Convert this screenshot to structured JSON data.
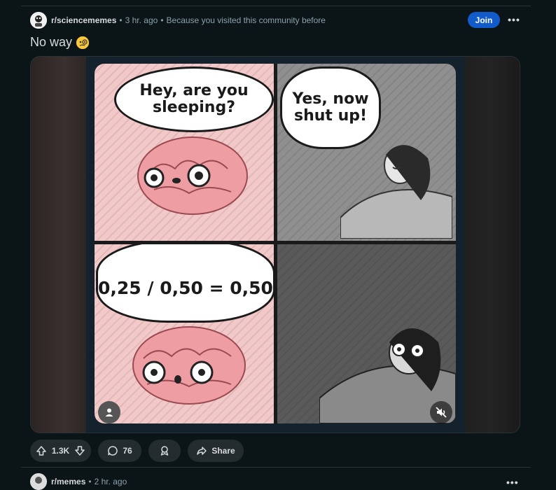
{
  "post": {
    "subreddit": "r/sciencememes",
    "time": "3 hr. ago",
    "reason": "Because you visited this community before",
    "join_label": "Join",
    "more_label": "•••",
    "title": "No way",
    "title_emoji": "face-with-monocle"
  },
  "meme": {
    "panel1_text": "Hey, are you sleeping?",
    "panel2_text": "Yes, now shut up!",
    "panel3_text": "0,25 / 0,50 = 0,50"
  },
  "actions": {
    "vote_count": "1.3K",
    "comments_count": "76",
    "share_label": "Share"
  },
  "next_post": {
    "subreddit": "r/memes",
    "time": "2 hr. ago",
    "more_label": "•••"
  },
  "colors": {
    "background": "#0b1416",
    "join_button": "#115bca",
    "pill": "#252c2f",
    "comic_pink": "#f2c9c8"
  }
}
